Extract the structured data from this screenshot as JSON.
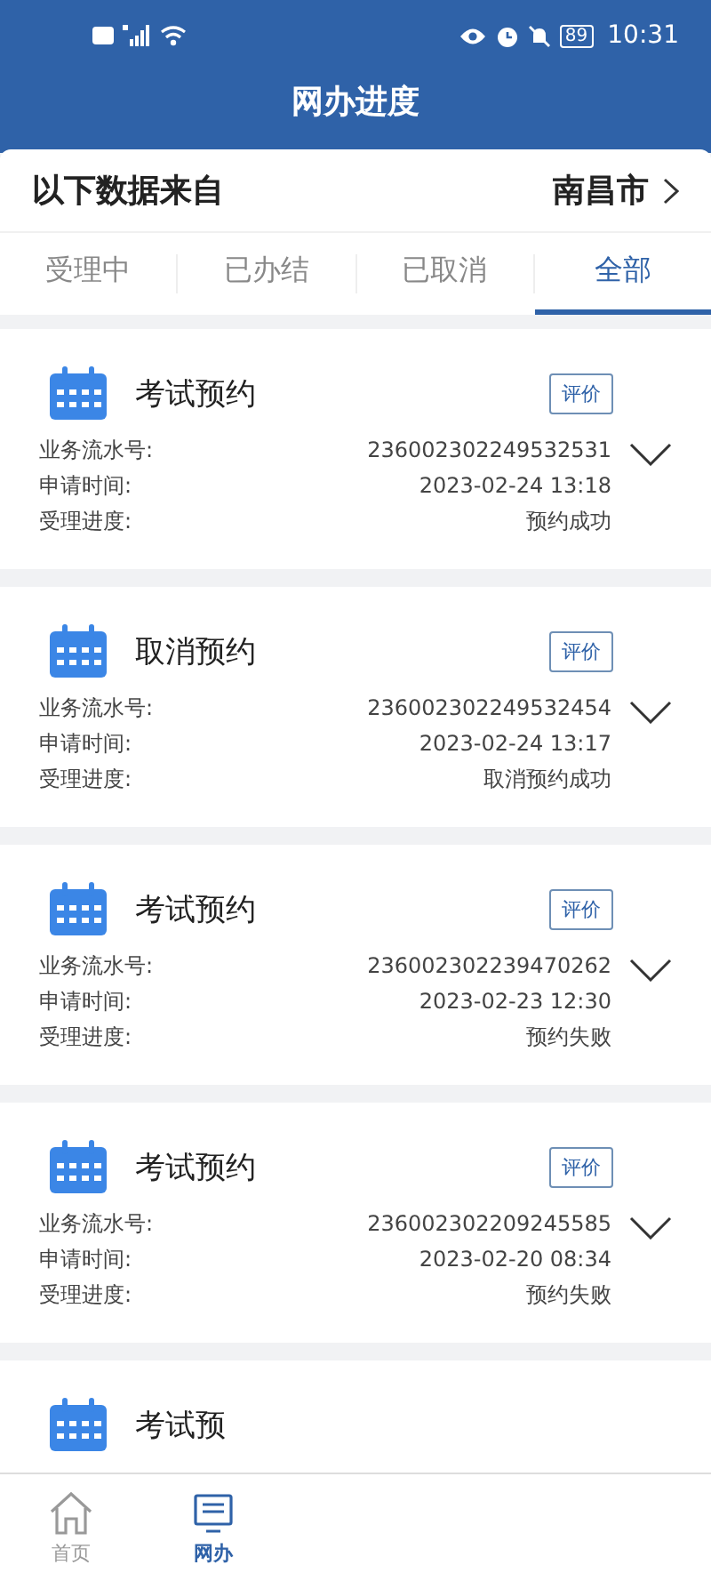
{
  "status_bar": {
    "time": "10:31",
    "battery": "89"
  },
  "header": {
    "title": "网办进度"
  },
  "source": {
    "label": "以下数据来自",
    "city": "南昌市"
  },
  "tabs": [
    {
      "label": "受理中",
      "selected": false
    },
    {
      "label": "已办结",
      "selected": false
    },
    {
      "label": "已取消",
      "selected": false
    },
    {
      "label": "全部",
      "selected": true
    }
  ],
  "records": [
    {
      "title": "考试预约",
      "rate_button": "评价",
      "fields": [
        {
          "label": "业务流水号:",
          "value": "236002302249532531"
        },
        {
          "label": "申请时间:",
          "value": "2023-02-24 13:18"
        },
        {
          "label": "受理进度:",
          "value": "预约成功"
        }
      ]
    },
    {
      "title": "取消预约",
      "rate_button": "评价",
      "fields": [
        {
          "label": "业务流水号:",
          "value": "236002302249532454"
        },
        {
          "label": "申请时间:",
          "value": "2023-02-24 13:17"
        },
        {
          "label": "受理进度:",
          "value": "取消预约成功"
        }
      ]
    },
    {
      "title": "考试预约",
      "rate_button": "评价",
      "fields": [
        {
          "label": "业务流水号:",
          "value": "236002302239470262"
        },
        {
          "label": "申请时间:",
          "value": "2023-02-23 12:30"
        },
        {
          "label": "受理进度:",
          "value": "预约失败"
        }
      ]
    },
    {
      "title": "考试预约",
      "rate_button": "评价",
      "fields": [
        {
          "label": "业务流水号:",
          "value": "236002302209245585"
        },
        {
          "label": "申请时间:",
          "value": "2023-02-20 08:34"
        },
        {
          "label": "受理进度:",
          "value": "预约失败"
        }
      ]
    },
    {
      "title": "考试预"
    }
  ],
  "bottom_nav": [
    {
      "label": "首页",
      "kind": "home",
      "selected": false
    },
    {
      "label": "网办",
      "kind": "progress",
      "selected": true
    }
  ]
}
